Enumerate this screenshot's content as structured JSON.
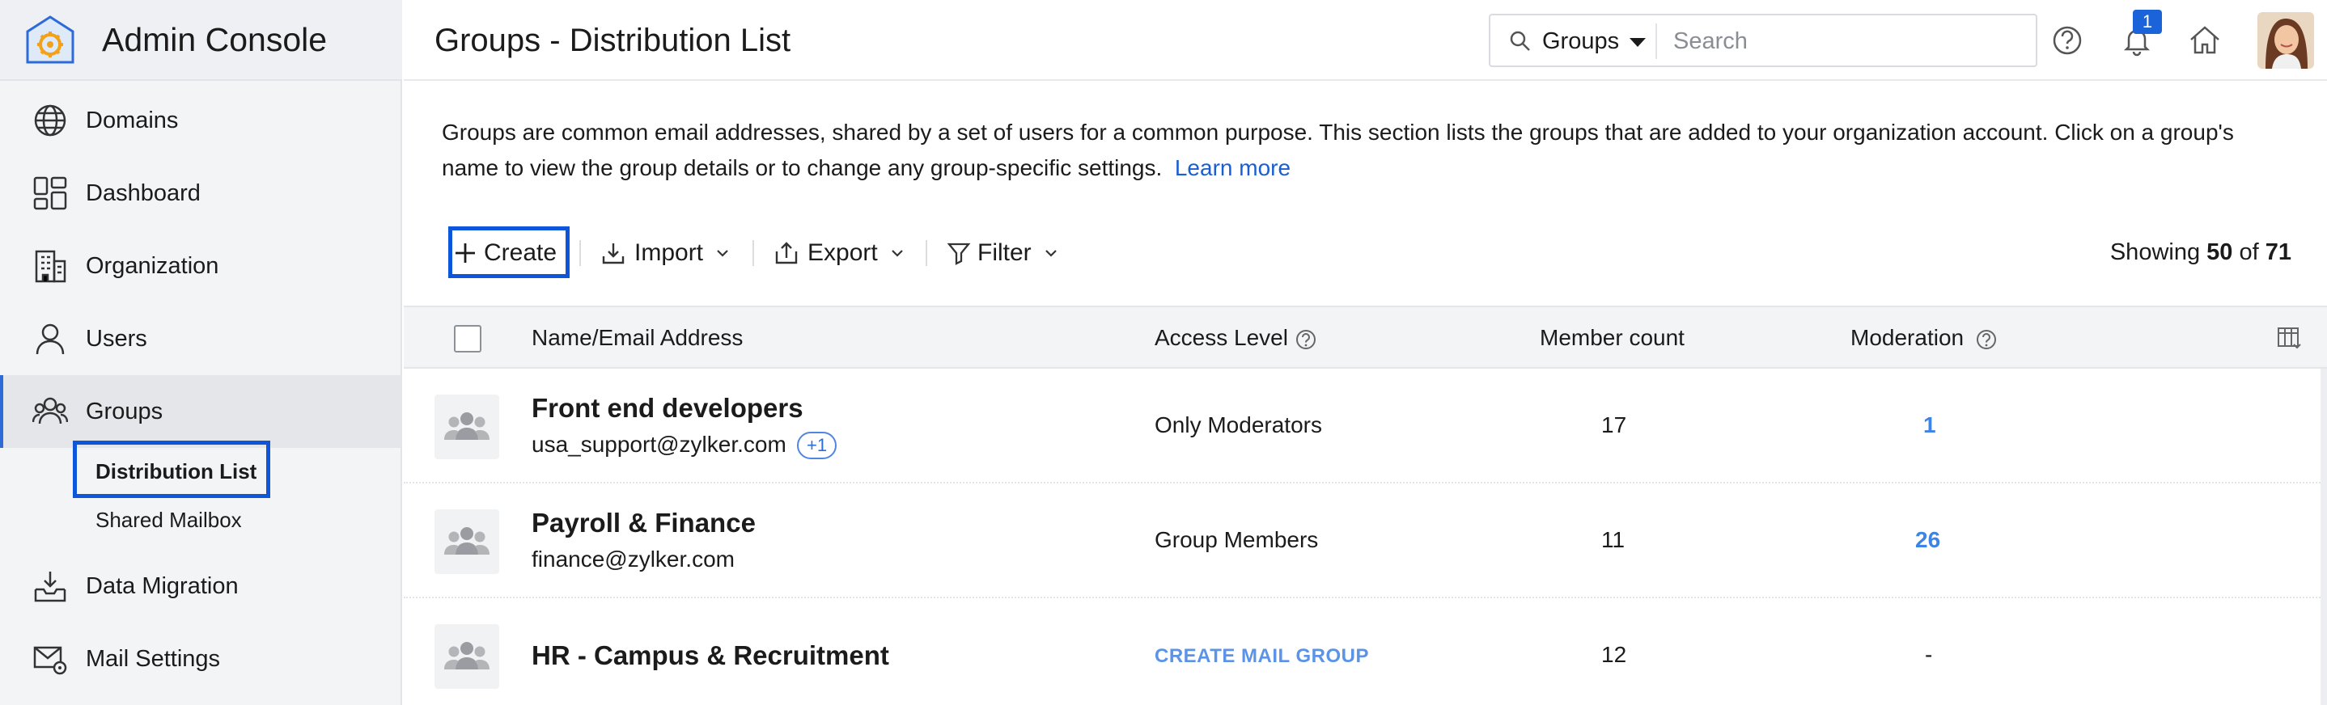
{
  "brand": {
    "title": "Admin Console"
  },
  "sidebar": {
    "items": [
      {
        "label": "Domains",
        "icon": "globe-icon"
      },
      {
        "label": "Dashboard",
        "icon": "dashboard-icon"
      },
      {
        "label": "Organization",
        "icon": "building-icon"
      },
      {
        "label": "Users",
        "icon": "user-icon"
      },
      {
        "label": "Groups",
        "icon": "groups-icon"
      },
      {
        "label": "Data Migration",
        "icon": "inbox-download-icon"
      },
      {
        "label": "Mail Settings",
        "icon": "mail-settings-icon"
      }
    ],
    "subitems": [
      {
        "label": "Distribution List"
      },
      {
        "label": "Shared Mailbox"
      }
    ]
  },
  "header": {
    "title": "Groups - Distribution List",
    "search_scope": "Groups",
    "search_placeholder": "Search",
    "notification_count": "1"
  },
  "description": {
    "text": "Groups are common email addresses, shared by a set of users for a common purpose. This section lists the groups that are added to your organization account. Click on a group's name to view the group details or to change any group-specific settings.",
    "link": "Learn more"
  },
  "toolbar": {
    "create": "Create",
    "import": "Import",
    "export": "Export",
    "filter": "Filter",
    "showing_prefix": "Showing",
    "showing_count": "50",
    "showing_of": "of",
    "showing_total": "71"
  },
  "table": {
    "headers": {
      "name": "Name/Email Address",
      "access": "Access Level",
      "members": "Member count",
      "moderation": "Moderation"
    },
    "rows": [
      {
        "name": "Front end developers",
        "email": "usa_support@zylker.com",
        "extra": "+1",
        "access": "Only Moderators",
        "members": "17",
        "moderation": "1"
      },
      {
        "name": "Payroll & Finance",
        "email": "finance@zylker.com",
        "access": "Group Members",
        "members": "11",
        "moderation": "26"
      },
      {
        "name": "HR - Campus & Recruitment",
        "access_action": "CREATE MAIL GROUP",
        "members": "12",
        "moderation": "-"
      }
    ]
  },
  "colors": {
    "accent": "#1a5fd0",
    "highlight_box": "#0d56d9",
    "moderation_link": "#3d84e6",
    "sidebar_bg": "#f3f4f6"
  }
}
